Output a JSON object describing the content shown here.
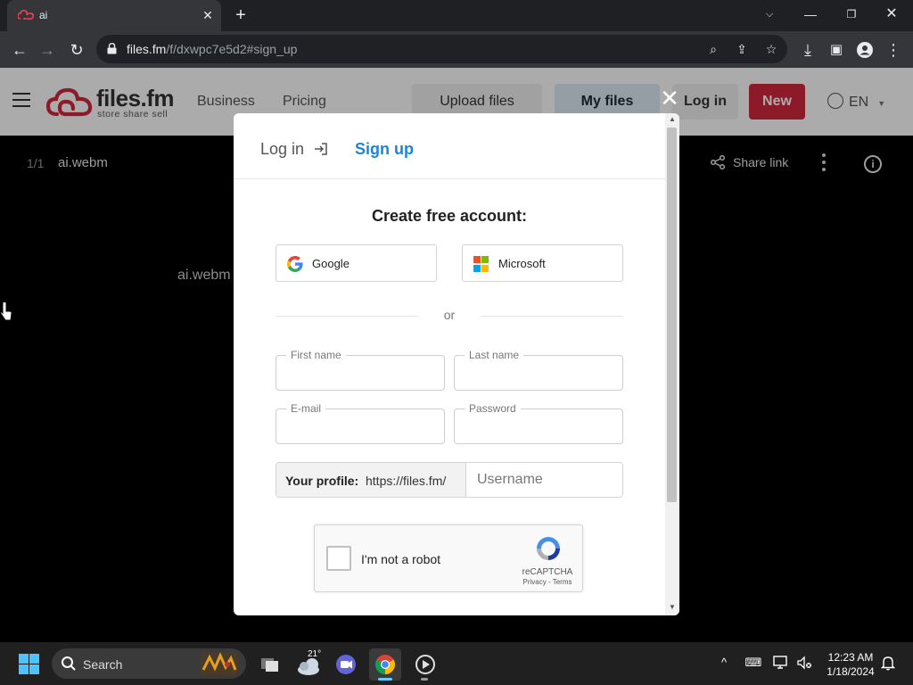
{
  "browser": {
    "tab_title": "ai",
    "url_domain": "files.fm",
    "url_path": "/f/dxwpc7e5d2#sign_up"
  },
  "site": {
    "logo_name": "files.fm",
    "logo_tagline": "store share sell",
    "nav": [
      "Business",
      "Pricing"
    ],
    "upload_label": "Upload files",
    "myfiles_label": "My files",
    "login_label": "Log in",
    "new_label": "New",
    "language": "EN",
    "brand_color": "#d2283c"
  },
  "file": {
    "count": "1/1",
    "name": "ai.webm",
    "share_label": "Share link",
    "preview_name": "ai.webm"
  },
  "modal": {
    "tab_login": "Log in",
    "tab_signup": "Sign up",
    "title": "Create free account:",
    "google_label": "Google",
    "microsoft_label": "Microsoft",
    "or_text": "or",
    "fields": {
      "first_name": "First name",
      "last_name": "Last name",
      "email": "E-mail",
      "password": "Password"
    },
    "profile_label": "Your profile:",
    "profile_url": "https://files.fm/",
    "username_placeholder": "Username",
    "recaptcha": {
      "label": "I'm not a robot",
      "brand": "reCAPTCHA",
      "links": "Privacy - Terms"
    },
    "accent_color": "#1c84d9"
  },
  "taskbar": {
    "search_label": "Search",
    "weather_temp": "21°",
    "time": "12:23 AM",
    "date": "1/18/2024"
  }
}
